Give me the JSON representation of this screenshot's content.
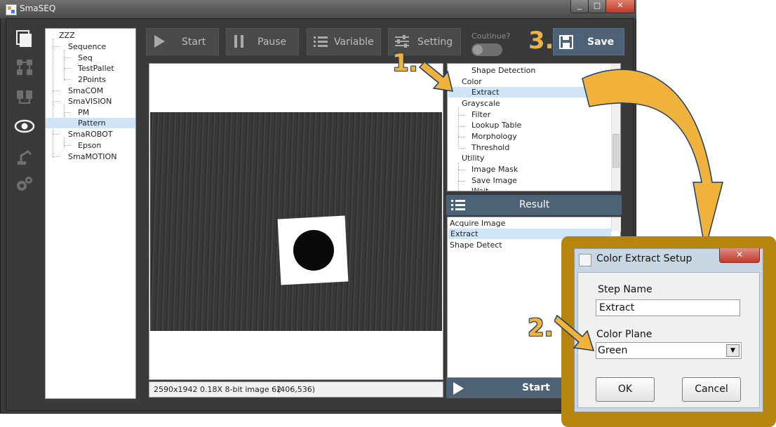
{
  "window": {
    "title": "SmaSEQ",
    "min": "_",
    "max": "□",
    "close": "✕"
  },
  "rail": [
    "page-icon",
    "flow-icon",
    "modules-icon",
    "eye-icon",
    "robot-arm-icon",
    "gears-icon"
  ],
  "tree": {
    "root": "ZZZ",
    "items": [
      "Sequence",
      "Seq",
      "TestPallet",
      "2Points",
      "SmaCOM",
      "SmaVISION",
      "PM",
      "Pattern",
      "SmaROBOT",
      "Epson",
      "SmaMOTION"
    ]
  },
  "toolbar": {
    "start": "Start",
    "pause": "Pause",
    "variable": "Variable",
    "setting": "Setting",
    "continue_label": "Coutinue?",
    "save": "Save"
  },
  "status_bar": {
    "info": "2590x1942 0.18X 8-bit image 62",
    "coords": "(406,536)"
  },
  "step_list": [
    "Shape Detection",
    "Color",
    "Extract",
    "Grayscale",
    "Filter",
    "Lookup Table",
    "Morphology",
    "Threshold",
    "Utility",
    "Image Mask",
    "Save Image",
    "Wait"
  ],
  "result": {
    "title": "Result",
    "items": [
      "Acquire Image",
      "Extract",
      "Shape Detect"
    ],
    "start": "Start"
  },
  "dialog": {
    "title": "Color Extract Setup",
    "close": "✕",
    "step_name_label": "Step Name",
    "step_name_value": "Extract",
    "color_plane_label": "Color Plane",
    "color_plane_value": "Green",
    "ok": "OK",
    "cancel": "Cancel"
  },
  "markers": {
    "m1": "1.",
    "m2": "2.",
    "m3": "3."
  },
  "colors": {
    "accent": "#4d6276",
    "highlight": "#cfe5f5",
    "callout": "#f0b23a",
    "frame": "#b5850d"
  }
}
